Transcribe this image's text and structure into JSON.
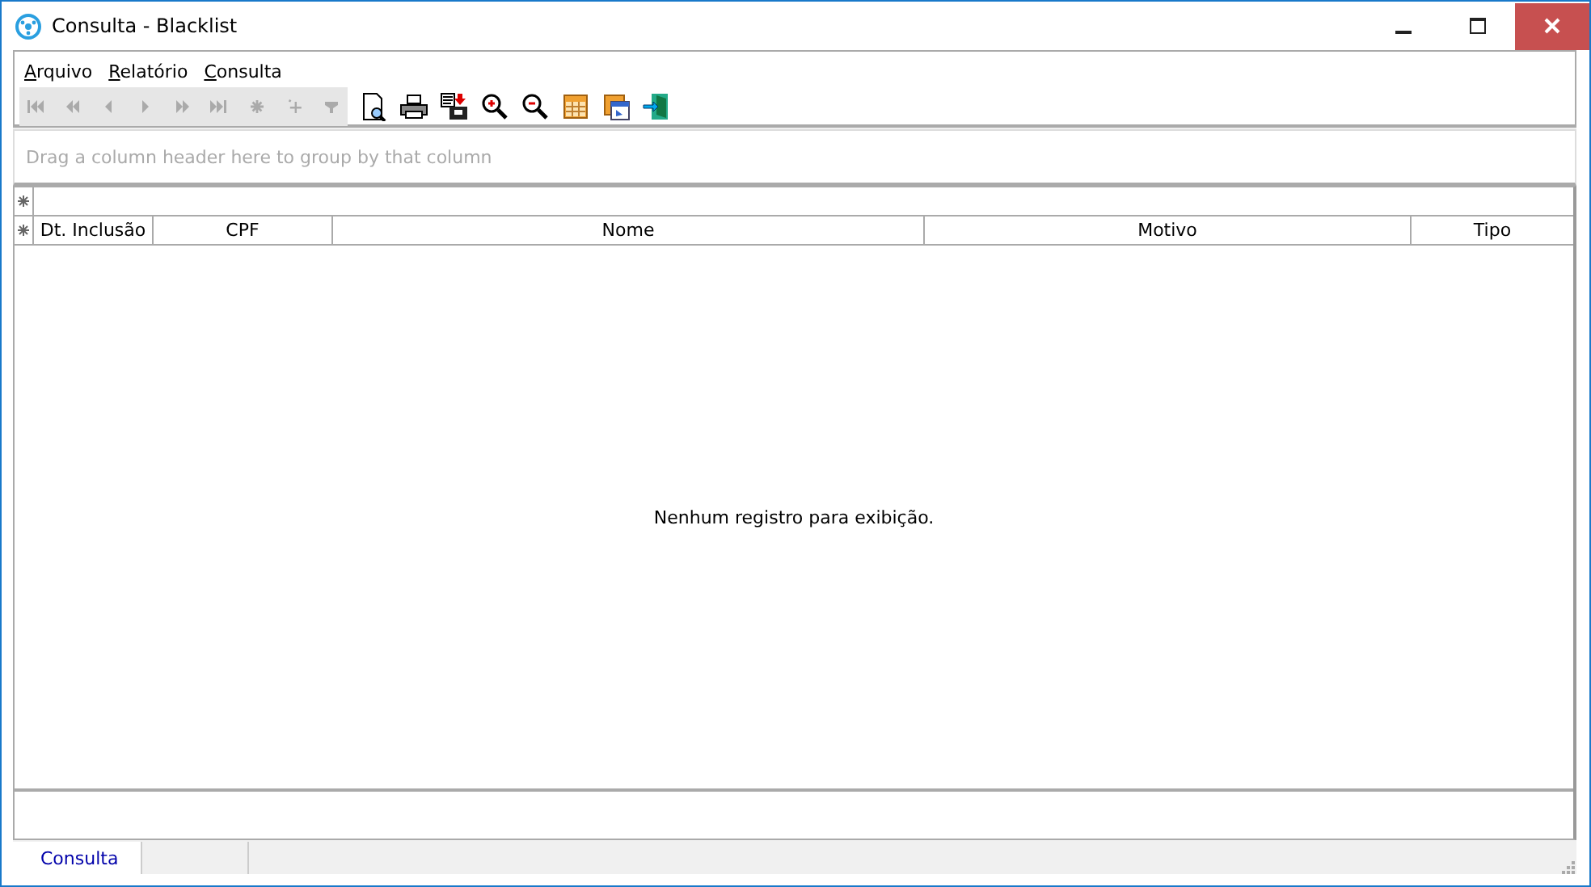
{
  "window": {
    "title": "Consulta - Blacklist"
  },
  "menu": [
    {
      "label": "Arquivo"
    },
    {
      "label": "Relatório"
    },
    {
      "label": "Consulta"
    }
  ],
  "navigator": [
    {
      "kind": "first",
      "disabled": true
    },
    {
      "kind": "prior-page",
      "disabled": true
    },
    {
      "kind": "prior",
      "disabled": true
    },
    {
      "kind": "next",
      "disabled": true
    },
    {
      "kind": "next-page",
      "disabled": true
    },
    {
      "kind": "last",
      "disabled": true
    },
    {
      "kind": "insert",
      "disabled": true
    },
    {
      "kind": "cancel",
      "disabled": true
    },
    {
      "kind": "filter",
      "disabled": true
    }
  ],
  "toolbar": [
    {
      "kind": "preview"
    },
    {
      "kind": "print"
    },
    {
      "kind": "export"
    },
    {
      "kind": "zoom-in"
    },
    {
      "kind": "zoom-out"
    },
    {
      "kind": "layout"
    },
    {
      "kind": "window"
    },
    {
      "kind": "exit"
    }
  ],
  "group_panel": {
    "placeholder": "Drag a column header here to group by that column"
  },
  "grid": {
    "columns": [
      "Dt. Inclusão",
      "CPF",
      "Nome",
      "Motivo",
      "Tipo"
    ],
    "empty_message": "Nenhum registro para exibição."
  },
  "status_bar": {
    "tabs": [
      {
        "label": "Consulta",
        "selected": true
      }
    ]
  }
}
